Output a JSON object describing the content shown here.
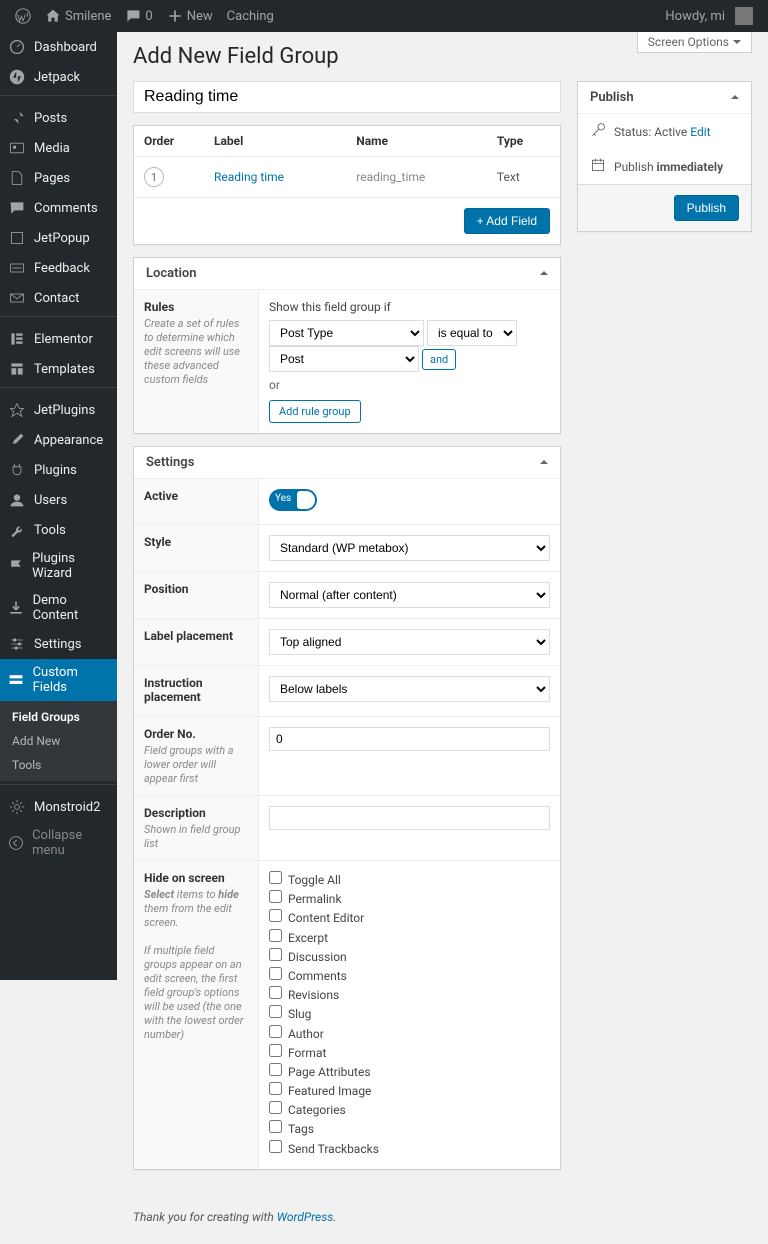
{
  "adminbar": {
    "site_name": "Smilene",
    "comments_count": "0",
    "new_label": "New",
    "caching_label": "Caching",
    "howdy": "Howdy, mi"
  },
  "menu": {
    "dashboard": "Dashboard",
    "jetpack": "Jetpack",
    "posts": "Posts",
    "media": "Media",
    "pages": "Pages",
    "comments": "Comments",
    "jetpopup": "JetPopup",
    "feedback": "Feedback",
    "contact": "Contact",
    "elementor": "Elementor",
    "templates": "Templates",
    "jetplugins": "JetPlugins",
    "appearance": "Appearance",
    "plugins": "Plugins",
    "users": "Users",
    "tools": "Tools",
    "plugins_wizard": "Plugins Wizard",
    "demo_content": "Demo Content",
    "settings": "Settings",
    "custom_fields": "Custom Fields",
    "sub_field_groups": "Field Groups",
    "sub_add_new": "Add New",
    "sub_tools": "Tools",
    "monstroid": "Monstroid2",
    "collapse": "Collapse menu"
  },
  "screen_options": "Screen Options",
  "page_title": "Add New Field Group",
  "group_title_value": "Reading time",
  "fields_table": {
    "col_order": "Order",
    "col_label": "Label",
    "col_name": "Name",
    "col_type": "Type",
    "rows": [
      {
        "order": "1",
        "label": "Reading time",
        "name": "reading_time",
        "type": "Text"
      }
    ],
    "add_field_btn": "+ Add Field"
  },
  "location": {
    "heading": "Location",
    "rules_label": "Rules",
    "rules_desc": "Create a set of rules to determine which edit screens will use these advanced custom fields",
    "show_if": "Show this field group if",
    "param": "Post Type",
    "operator": "is equal to",
    "value": "Post",
    "and": "and",
    "or": "or",
    "add_rule_group": "Add rule group"
  },
  "settings": {
    "heading": "Settings",
    "active_label": "Active",
    "active_yes": "Yes",
    "style_label": "Style",
    "style_value": "Standard (WP metabox)",
    "position_label": "Position",
    "position_value": "Normal (after content)",
    "label_placement_label": "Label placement",
    "label_placement_value": "Top aligned",
    "instruction_placement_label": "Instruction placement",
    "instruction_placement_value": "Below labels",
    "orderno_label": "Order No.",
    "orderno_desc": "Field groups with a lower order will appear first",
    "orderno_value": "0",
    "description_label": "Description",
    "description_desc": "Shown in field group list",
    "hide_label": "Hide on screen",
    "hide_desc1": "Select items to hide them from the edit screen.",
    "hide_desc2": "If multiple field groups appear on an edit screen, the first field group's options will be used (the one with the lowest order number)",
    "hide_items": [
      "Toggle All",
      "Permalink",
      "Content Editor",
      "Excerpt",
      "Discussion",
      "Comments",
      "Revisions",
      "Slug",
      "Author",
      "Format",
      "Page Attributes",
      "Featured Image",
      "Categories",
      "Tags",
      "Send Trackbacks"
    ]
  },
  "publish": {
    "heading": "Publish",
    "status_label": "Status:",
    "status_value": "Active",
    "edit": "Edit",
    "publish_on": "Publish",
    "publish_on_value": "immediately",
    "button": "Publish"
  },
  "footer": {
    "thank": "Thank you for creating with ",
    "wp": "WordPress",
    "dot": "."
  }
}
